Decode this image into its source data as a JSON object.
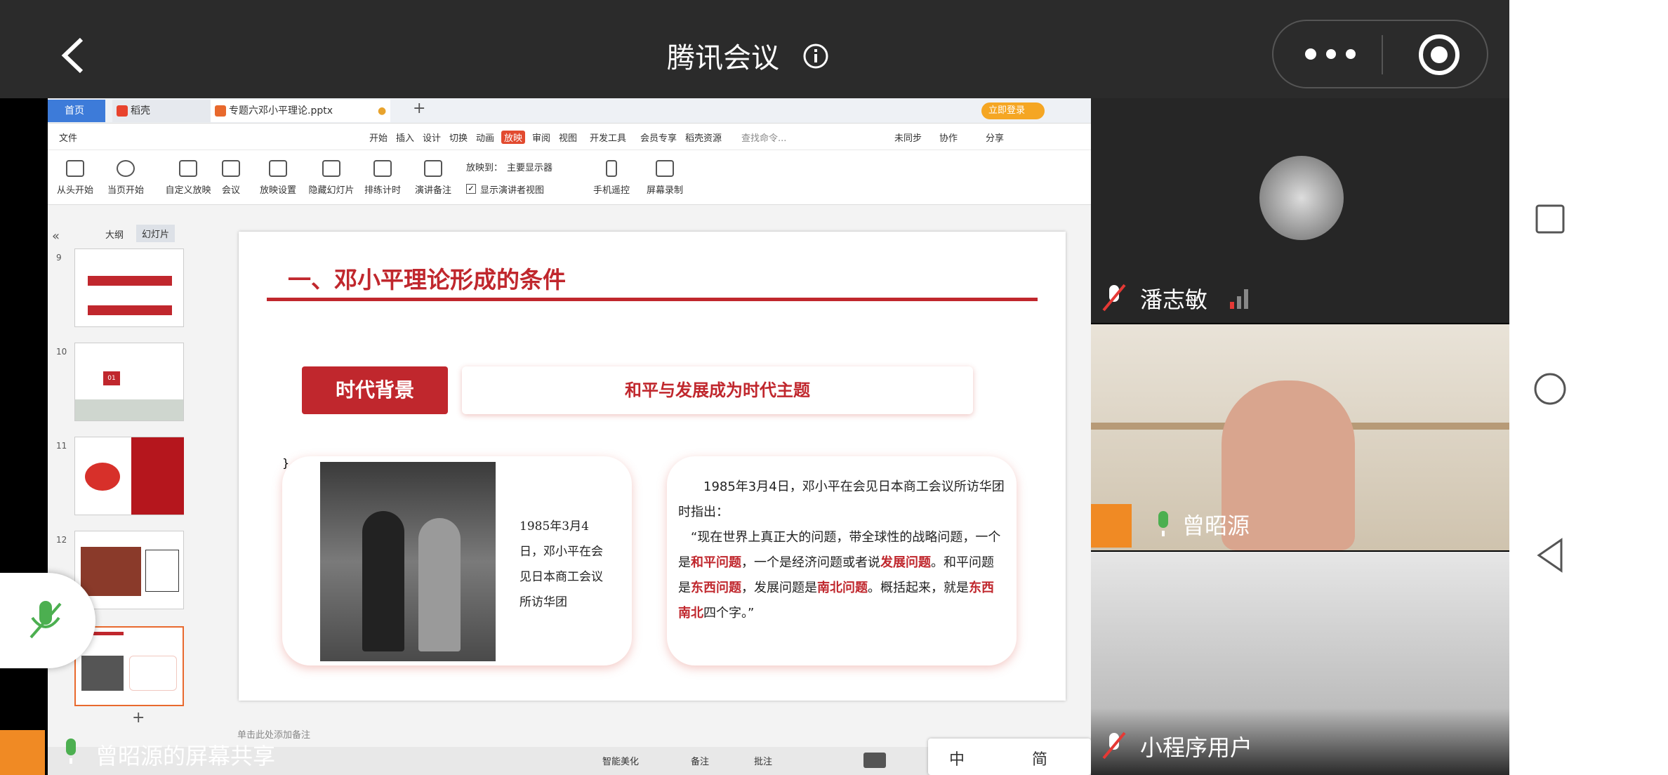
{
  "app": {
    "title": "腾讯会议",
    "back_icon": "back-arrow-icon",
    "info_icon": "info-icon",
    "more_icon": "more-dots-icon",
    "record_icon": "record-icon"
  },
  "wps": {
    "tabs": [
      "首页",
      "稻壳",
      "专题六邓小平理论.pptx"
    ],
    "login_button": "立即登录",
    "menu": [
      "文件",
      "开始",
      "插入",
      "设计",
      "切换",
      "动画",
      "放映",
      "审阅",
      "视图",
      "开发工具",
      "会员专享",
      "稻壳资源"
    ],
    "search_placeholder": "查找命令...",
    "right_actions": [
      "未同步",
      "协作",
      "分享"
    ],
    "tools": [
      "从头开始",
      "当页开始",
      "自定义放映",
      "会议",
      "放映设置",
      "隐藏幻灯片",
      "排练计时",
      "演讲备注",
      "手机遥控",
      "屏幕录制"
    ],
    "play_to_label": "放映到：",
    "play_to_value": "主要显示器",
    "presenter_view": "显示演讲者视图",
    "panel_tabs": [
      "大纲",
      "幻灯片"
    ],
    "slide_numbers": [
      "9",
      "10",
      "11",
      "12"
    ],
    "notes_placeholder": "单击此处添加备注",
    "status_items": [
      "智能美化",
      "备注",
      "批注"
    ],
    "ime": [
      "中",
      "简"
    ]
  },
  "slide": {
    "title": "一、邓小平理论形成的条件",
    "badge": "时代背景",
    "theme": "和平与发展成为时代主题",
    "photo_caption": "1985年3月4日，邓小平在会见日本商工会议所访华团",
    "quote_intro": "1985年3月4日，邓小平在会见日本商工会议所访华团时指出：",
    "quote_p1": "“现在世界上真正大的问题，带全球性的战略问题，一个是",
    "quote_h1": "和平问题",
    "quote_p2": "，一个是经济问题或者说",
    "quote_h2": "发展问题",
    "quote_p3": "。和平问题是",
    "quote_h3": "东西问题",
    "quote_p4": "，发展问题是",
    "quote_h4": "南北问题",
    "quote_p5": "。概括起来，就是",
    "quote_h5": "东西南北",
    "quote_p6": "四个字。”",
    "thumb10_num": "01"
  },
  "participants": [
    {
      "name": "潘志敏"
    },
    {
      "name": "曾昭源"
    },
    {
      "name": "小程序用户"
    }
  ],
  "screen_share_label": "曾昭源的屏幕共享"
}
